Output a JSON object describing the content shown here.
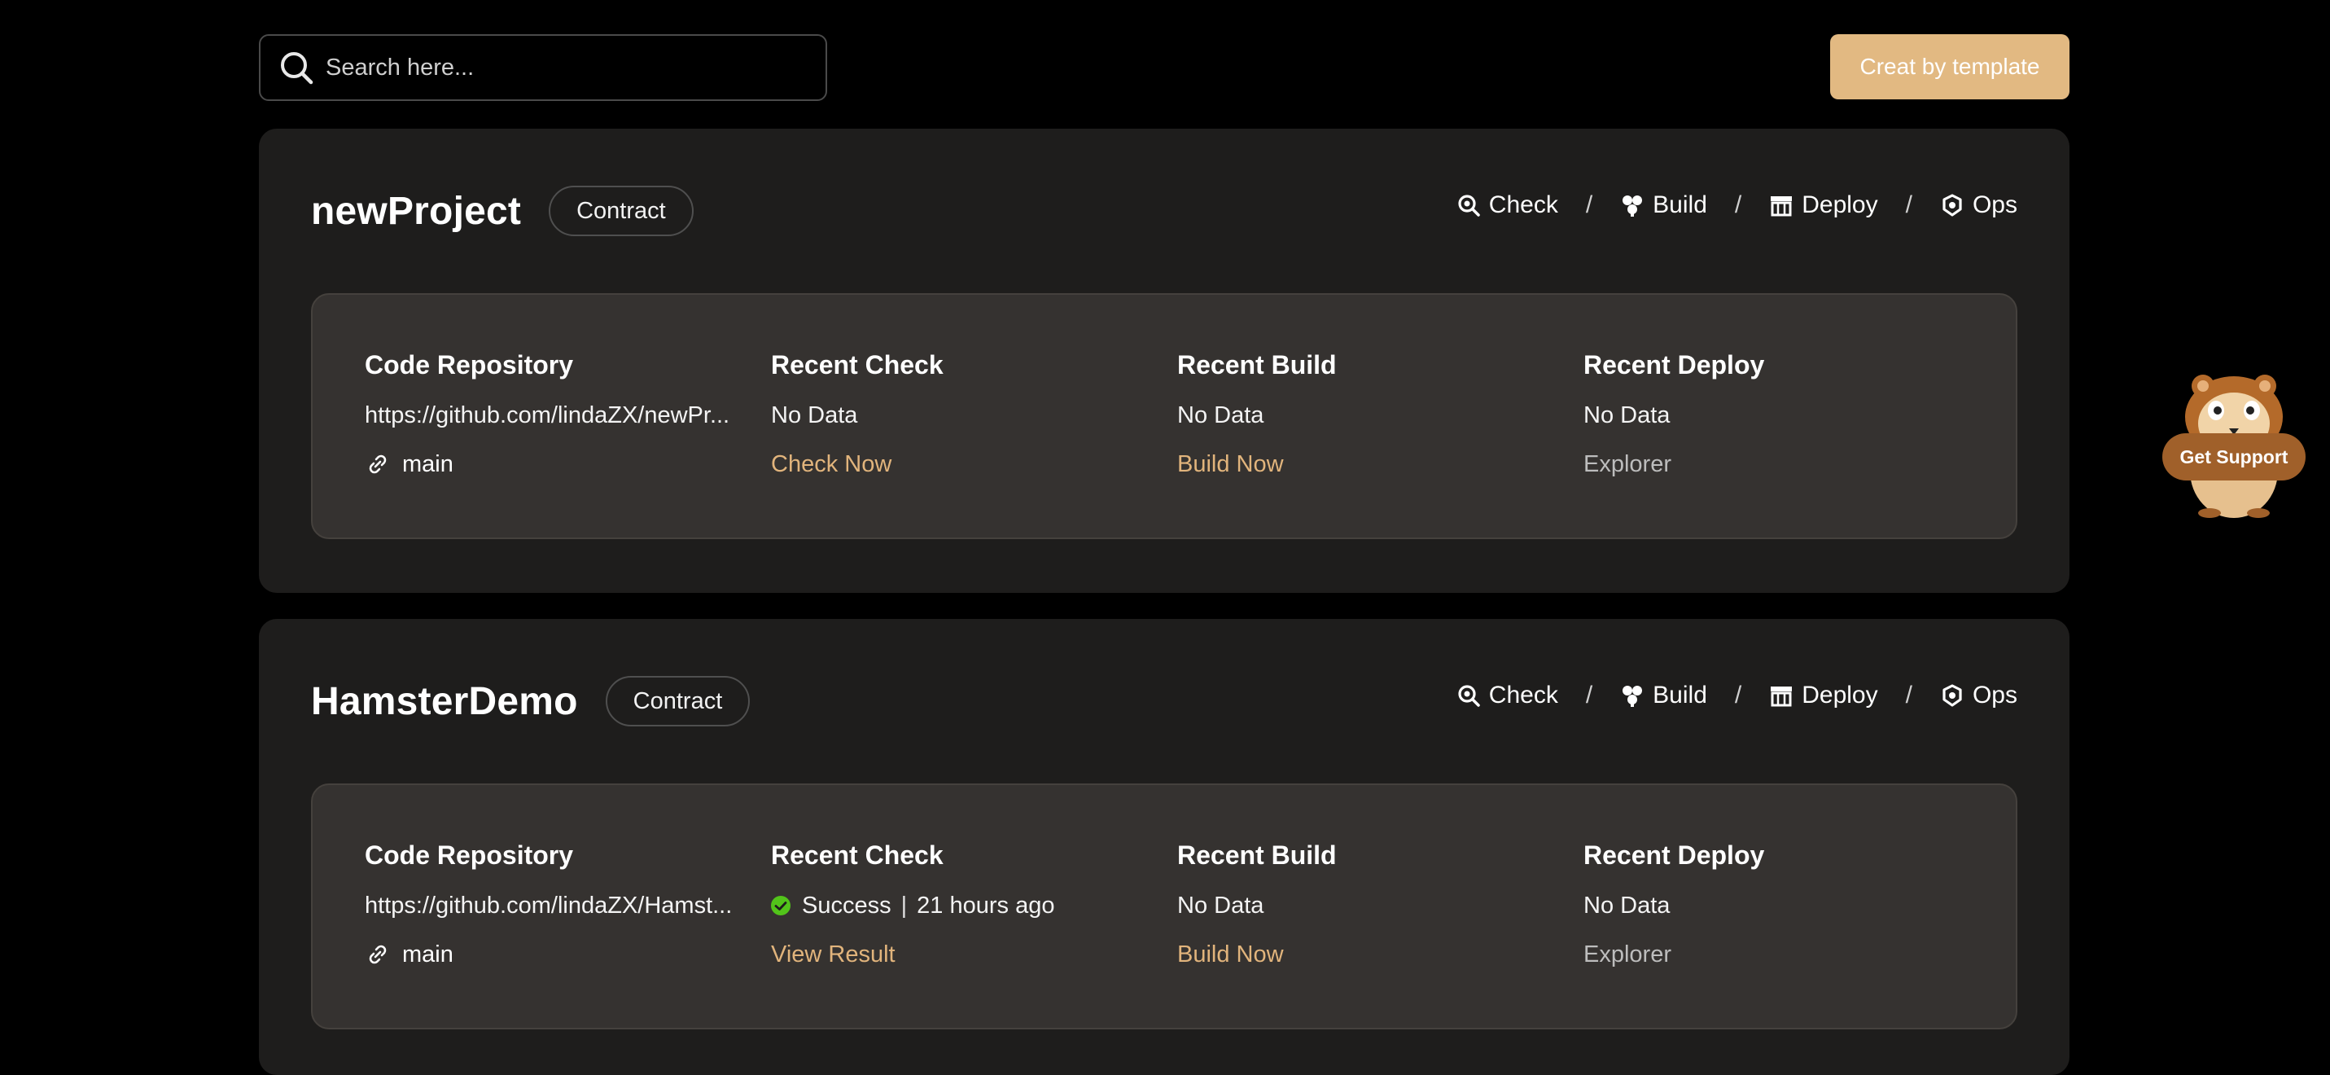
{
  "search": {
    "placeholder": "Search here..."
  },
  "header": {
    "template_button": "Creat by template"
  },
  "colors": {
    "accent": "#e2b982",
    "link_gold": "#e1b47c",
    "success": "#52c41a",
    "support": "#a0602a"
  },
  "nav_labels": {
    "check": "Check",
    "build": "Build",
    "deploy": "Deploy",
    "ops": "Ops",
    "separator": "/"
  },
  "columns": {
    "repo": "Code Repository",
    "check": "Recent Check",
    "build": "Recent Build",
    "deploy": "Recent Deploy"
  },
  "projects": [
    {
      "name": "newProject",
      "tag": "Contract",
      "repo_url": "https://github.com/lindaZX/newPr...",
      "branch": "main",
      "recent_check": "No Data",
      "check_action": "Check Now",
      "recent_build": "No Data",
      "build_action": "Build Now",
      "recent_deploy": "No Data",
      "deploy_action": "Explorer"
    },
    {
      "name": "HamsterDemo",
      "tag": "Contract",
      "repo_url": "https://github.com/lindaZX/Hamst...",
      "branch": "main",
      "recent_check_status": "Success",
      "recent_check_time": "21 hours ago",
      "check_action": "View Result",
      "recent_build": "No Data",
      "build_action": "Build Now",
      "recent_deploy": "No Data",
      "deploy_action": "Explorer"
    }
  ],
  "support": {
    "label": "Get Support"
  },
  "icons": [
    "search-icon",
    "check-icon",
    "build-icon",
    "deploy-icon",
    "ops-icon",
    "link-icon",
    "success-icon",
    "hamster-icon"
  ]
}
